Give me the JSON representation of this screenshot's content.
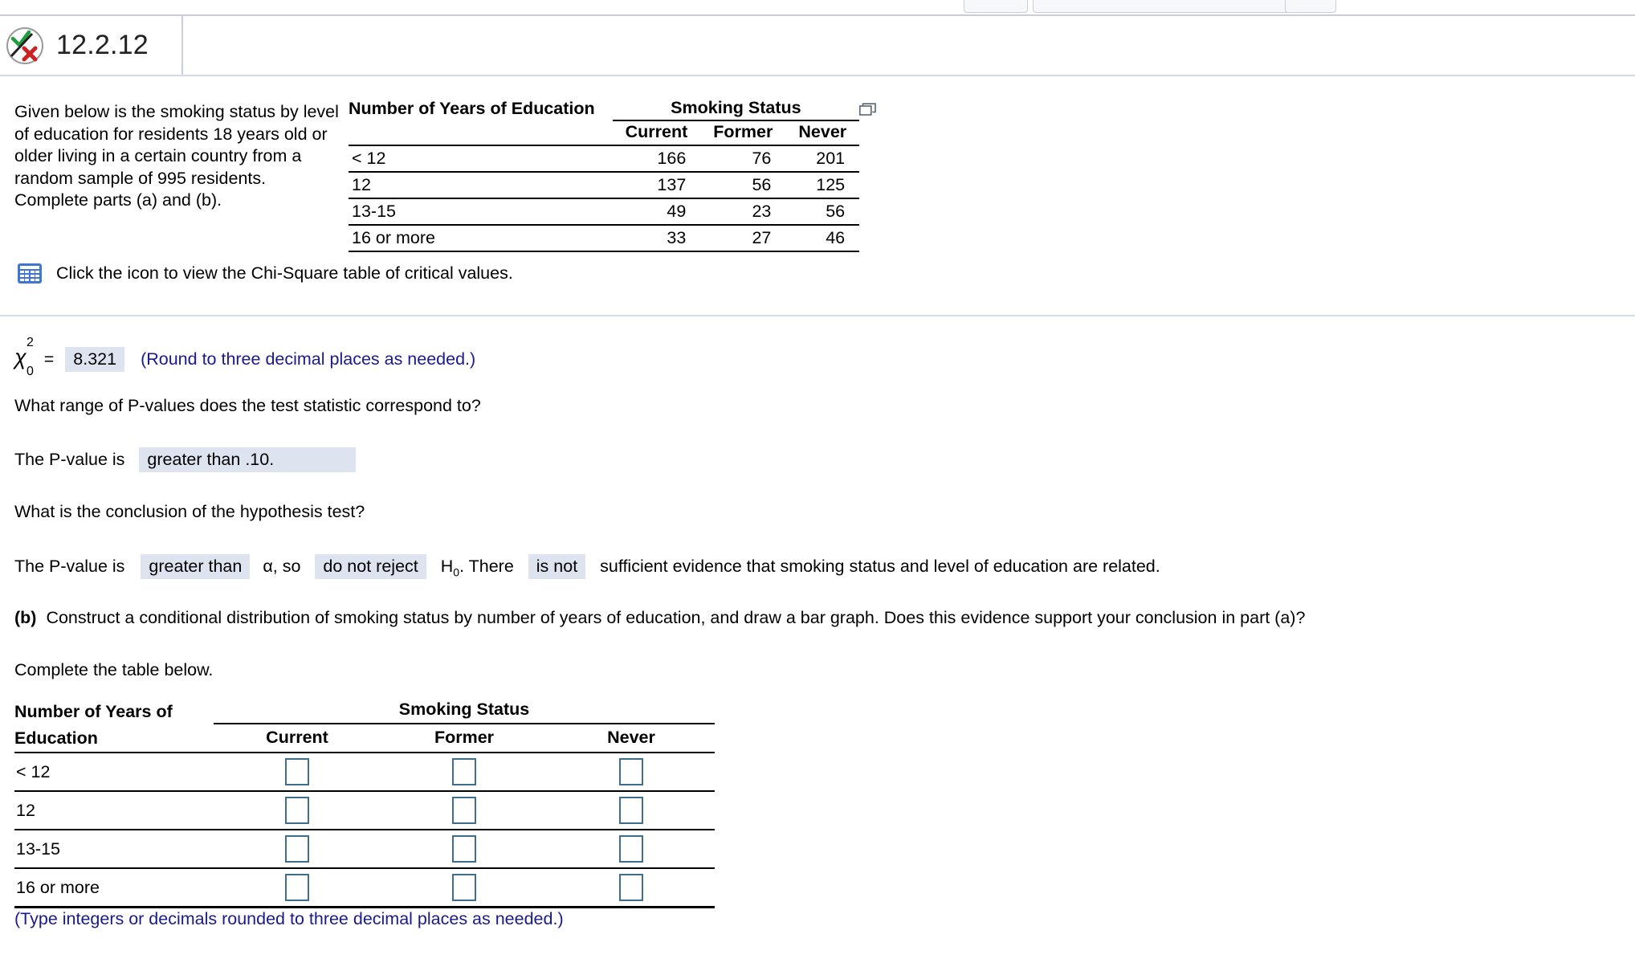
{
  "toolbar": {
    "control_a": "",
    "control_b": "",
    "control_c": ""
  },
  "header": {
    "question_number": "12.2.12",
    "status_icon": "check-cross-icon"
  },
  "problem": {
    "stem": "Given below is the smoking status by level of education for residents 18 years old or older living in a certain country from a random sample of 995 residents. Complete parts (a) and (b).",
    "chi_table_link": "Click the icon to view the Chi-Square table of critical values.",
    "popout_icon": "popout-window-icon",
    "grid_icon": "table-grid-icon"
  },
  "data_table": {
    "row_header": "Number of Years of Education",
    "group_header": "Smoking Status",
    "columns": [
      "Current",
      "Former",
      "Never"
    ],
    "rows": [
      {
        "label": "< 12",
        "values": [
          "166",
          "76",
          "201"
        ]
      },
      {
        "label": "12",
        "values": [
          "137",
          "56",
          "125"
        ]
      },
      {
        "label": "13-15",
        "values": [
          "49",
          "23",
          "56"
        ]
      },
      {
        "label": "16 or more",
        "values": [
          "33",
          "27",
          "46"
        ]
      }
    ]
  },
  "part_a": {
    "chi_symbol": "χ",
    "chi_superscript": "2",
    "chi_subscript": "0",
    "equals": "=",
    "chi_value": "8.321",
    "rounding_note": "(Round to three decimal places as needed.)",
    "pvalue_question": "What range of P-values does the test statistic correspond to?",
    "pvalue_prefix": "The P-value is",
    "pvalue_answer": "greater than .10.",
    "conclusion_question": "What is the conclusion of the hypothesis test?",
    "conclusion_prefix": "The P-value is",
    "conclusion_compare": "greater than",
    "conclusion_alpha": "α, so",
    "conclusion_decision": "do not reject",
    "conclusion_h0_prefix": "H",
    "conclusion_h0_sub": "0",
    "conclusion_there": ". There",
    "conclusion_evidence": "is not",
    "conclusion_tail": "sufficient evidence that smoking status and level of education are related."
  },
  "part_b": {
    "label": "(b)",
    "prompt": "Construct a conditional distribution of smoking status by number of years of education, and draw a bar graph. Does this evidence support your conclusion in part (a)?",
    "instruction": "Complete the table below.",
    "table": {
      "row_header_line1": "Number of Years of",
      "row_header_line2": "Education",
      "group_header": "Smoking Status",
      "columns": [
        "Current",
        "Former",
        "Never"
      ],
      "rows": [
        {
          "label": "< 12",
          "values": [
            "",
            "",
            ""
          ]
        },
        {
          "label": "12",
          "values": [
            "",
            "",
            ""
          ]
        },
        {
          "label": "13-15",
          "values": [
            "",
            "",
            ""
          ]
        },
        {
          "label": "16 or more",
          "values": [
            "",
            "",
            ""
          ]
        }
      ]
    },
    "note": "(Type integers or decimals rounded to three decimal places as needed.)"
  },
  "colors": {
    "answer_box_fill": "#dde3ef",
    "blue_text": "#1a1a8c",
    "input_border": "#3b6e8f",
    "icon_blue": "#3f76d4"
  }
}
